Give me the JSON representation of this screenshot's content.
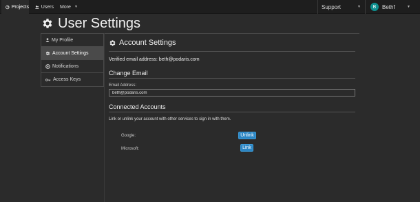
{
  "nav": {
    "projects": "Projects",
    "users": "Users",
    "more": "More"
  },
  "support": "Support",
  "user": {
    "name": "Bethf",
    "initial": "B"
  },
  "page_title": "User Settings",
  "sidebar": {
    "items": [
      {
        "label": "My Profile",
        "icon": "user-icon",
        "active": false
      },
      {
        "label": "Account Settings",
        "icon": "gear-icon",
        "active": true
      },
      {
        "label": "Notifications",
        "icon": "notification-icon",
        "active": false
      },
      {
        "label": "Access Keys",
        "icon": "key-icon",
        "active": false
      }
    ]
  },
  "main": {
    "heading": "Account Settings",
    "verified": "Verified email address: beth@podaris.com",
    "change_email": {
      "title": "Change Email",
      "label": "Email Address:",
      "value": "beth@podaris.com"
    },
    "connected": {
      "title": "Connected Accounts",
      "help": "Link or unlink your account with other services to sign in with them.",
      "providers": [
        {
          "name": "Google:",
          "action": "Unlink"
        },
        {
          "name": "Microsoft:",
          "action": "Link"
        }
      ]
    }
  },
  "colors": {
    "background": "#2b2b2b",
    "topbar": "#1e1e1e",
    "button": "#2c86c4",
    "avatar": "#0e8f8f"
  }
}
